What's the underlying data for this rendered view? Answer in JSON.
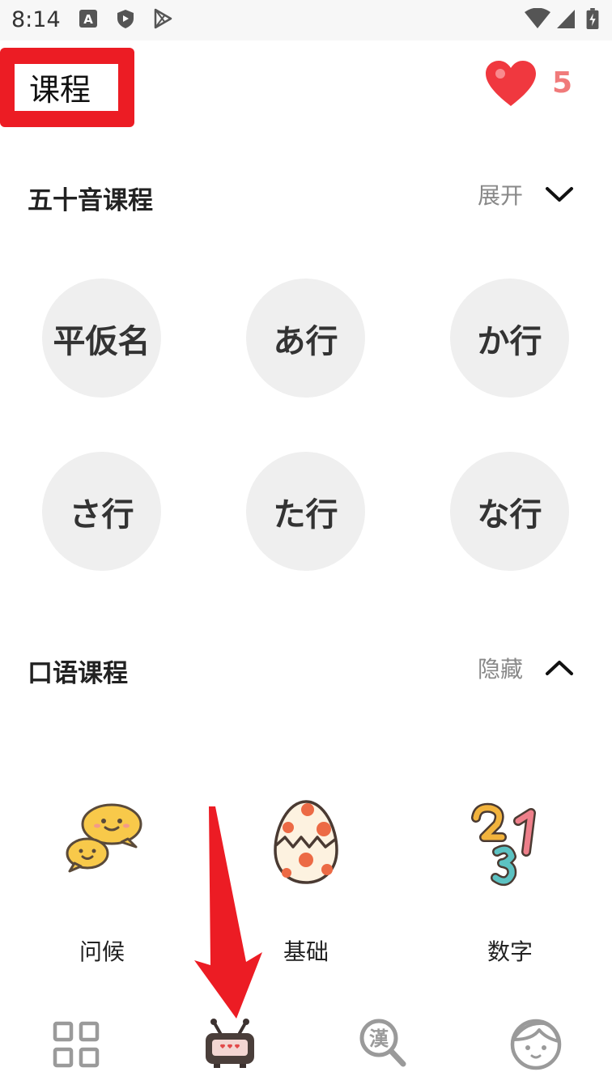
{
  "status": {
    "time": "8:14",
    "icons": [
      "keyboard-a-icon",
      "shield-icon",
      "play-store-icon",
      "wifi-icon",
      "signal-icon",
      "battery-icon"
    ]
  },
  "header": {
    "title": "课程",
    "hearts_count": "5",
    "heart_color": "#f0383f"
  },
  "kana_section": {
    "title": "五十音课程",
    "toggle_label": "展开",
    "items": [
      {
        "label": "平仮名"
      },
      {
        "label": "あ行"
      },
      {
        "label": "か行"
      },
      {
        "label": "さ行"
      },
      {
        "label": "た行"
      },
      {
        "label": "な行"
      }
    ]
  },
  "speaking_section": {
    "title": "口语课程",
    "toggle_label": "隐藏",
    "items": [
      {
        "label": "问候",
        "icon": "speech-bubbles-icon"
      },
      {
        "label": "基础",
        "icon": "cracked-egg-icon"
      },
      {
        "label": "数字",
        "icon": "numbers-icon"
      }
    ]
  },
  "tabbar": {
    "tabs": [
      {
        "icon": "grid-icon"
      },
      {
        "icon": "tv-icon"
      },
      {
        "icon": "kanji-search-icon"
      },
      {
        "icon": "profile-face-icon"
      }
    ]
  },
  "colors": {
    "accent_red": "#ec1c24",
    "circle_bg": "#efefef",
    "muted_text": "#888888"
  }
}
